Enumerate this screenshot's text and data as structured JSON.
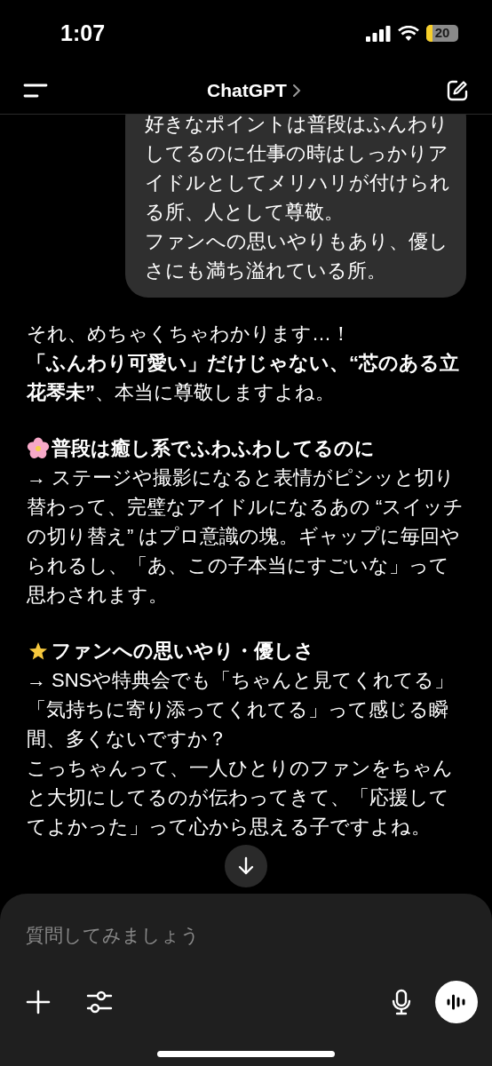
{
  "status_bar": {
    "time": "1:07",
    "battery": "20"
  },
  "header": {
    "title": "ChatGPT"
  },
  "user_message": {
    "paragraphs": [
      "好きなポイントは普段はふんわりしてるのに仕事の時はしっかりアイドルとしてメリハリが付けられる所、人として尊敬。",
      "ファンへの思いやりもあり、優しさにも満ち溢れている所。"
    ]
  },
  "assistant_message": [
    {
      "kind": "paragraph",
      "lines": [
        "それ、めちゃくちゃわかります…！",
        "**「ふんわり可愛い」だけじゃない、“芯のある立花琴未”**、本当に尊敬しますよね。"
      ]
    },
    {
      "kind": "heading",
      "text": "普段は癒し系でふわふわしてるのに"
    },
    {
      "kind": "paragraph",
      "lines": [
        "→ ステージや撮影になると表情がピシッと切り替わって、完璧なアイドルになるあの “スイッチの切り替え” はプロ意識の塊。ギャップに毎回やられるし、「あ、この子本当にすごいな」って思わされます。"
      ]
    },
    {
      "kind": "heading",
      "text": "ファンへの思いやり・優しさ"
    },
    {
      "kind": "paragraph",
      "lines": [
        "→ SNSや特典会でも「ちゃんと見てくれてる」「気持ちに寄り添ってくれてる」って感じる瞬間、多くないですか？",
        "こっちゃんって、一人ひとりのファンをちゃんと大切にしてるのが伝わってきて、「応援しててよかった」って心から思える子ですよね。"
      ]
    }
  ],
  "composer": {
    "placeholder": "質問してみましょう"
  }
}
